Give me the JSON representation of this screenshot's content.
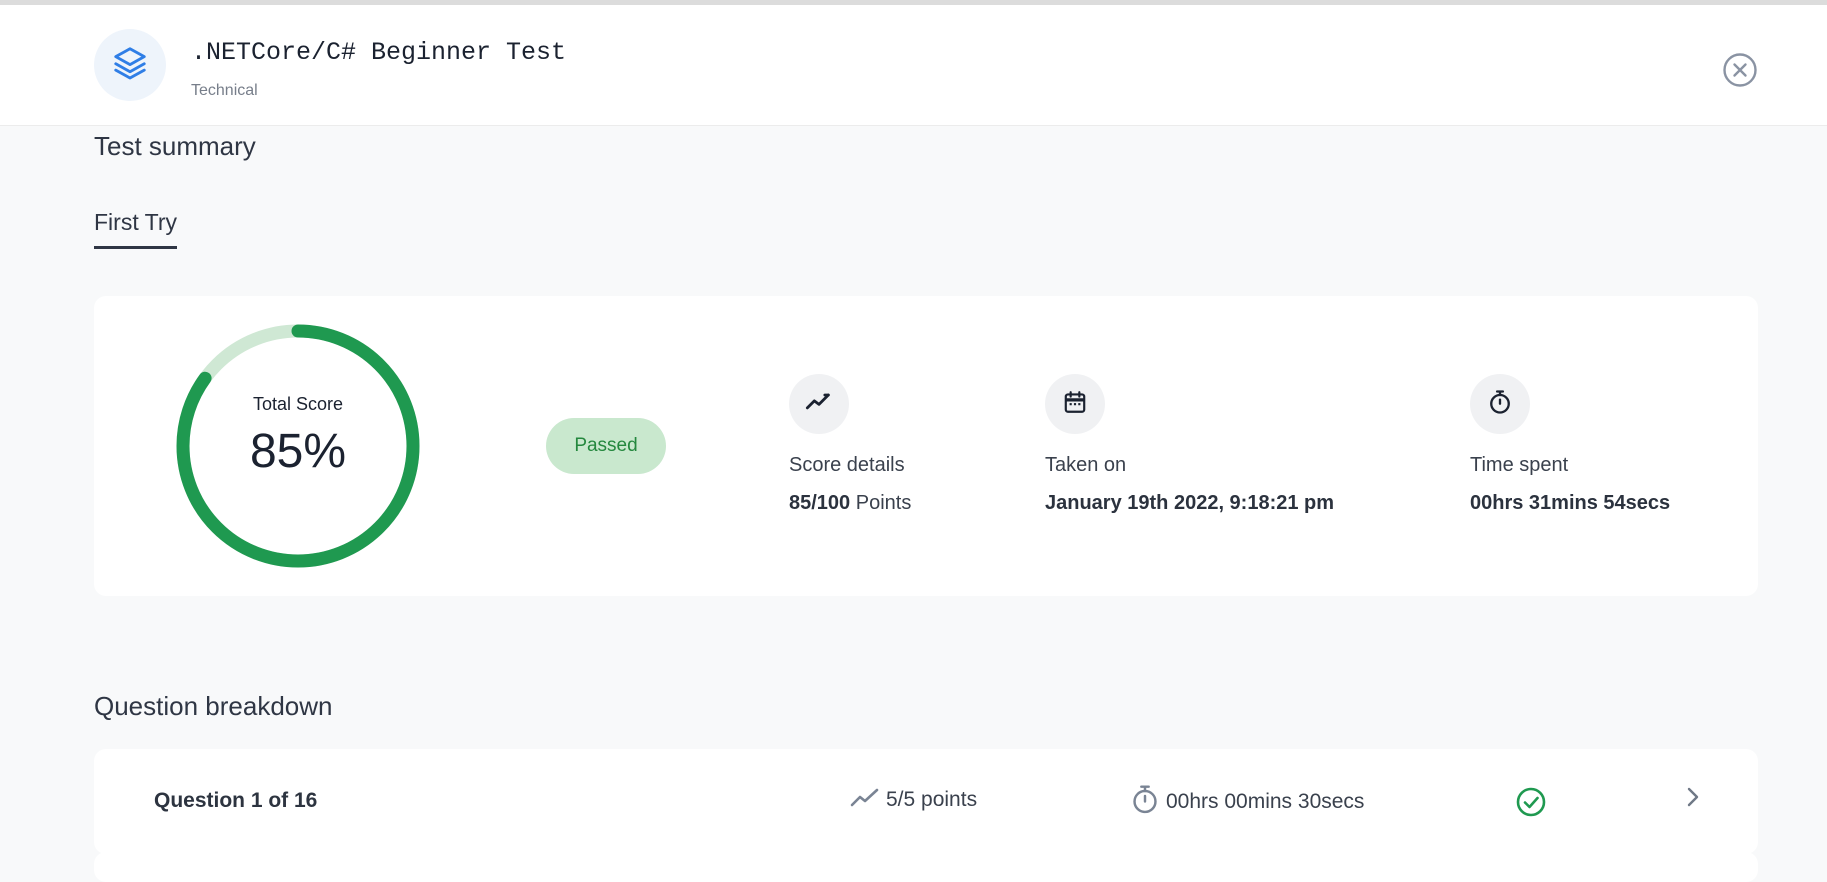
{
  "header": {
    "title": ".NETCore/C# Beginner Test",
    "category": "Technical",
    "logo_icon": "layers-icon",
    "close_icon": "close-circle-icon"
  },
  "summary": {
    "section_title": "Test summary",
    "tabs": [
      {
        "label": "First Try",
        "active": true
      }
    ],
    "total_score_label": "Total Score",
    "total_score_value": "85%",
    "score_fraction": 0.85,
    "status": "Passed",
    "stats": [
      {
        "icon": "trending-line-icon",
        "label": "Score details",
        "value_bold": "85/100",
        "value_rest": " Points"
      },
      {
        "icon": "calendar-icon",
        "label": "Taken on",
        "value_bold": "January 19th 2022, 9:18:21 pm",
        "value_rest": ""
      },
      {
        "icon": "stopwatch-icon",
        "label": "Time spent",
        "value_bold": "00hrs 31mins 54secs",
        "value_rest": ""
      }
    ]
  },
  "breakdown": {
    "section_title": "Question breakdown",
    "questions": [
      {
        "title": "Question 1 of 16",
        "points": "5/5 points",
        "time": "00hrs 00mins 30secs",
        "status_icon": "check-circle-icon"
      }
    ]
  },
  "colors": {
    "accent_green": "#1f9950",
    "track_green": "#cfe8d4",
    "pill_bg": "#c9e8ce",
    "pill_text": "#24883e",
    "logo_blue": "#2f7ee6"
  }
}
